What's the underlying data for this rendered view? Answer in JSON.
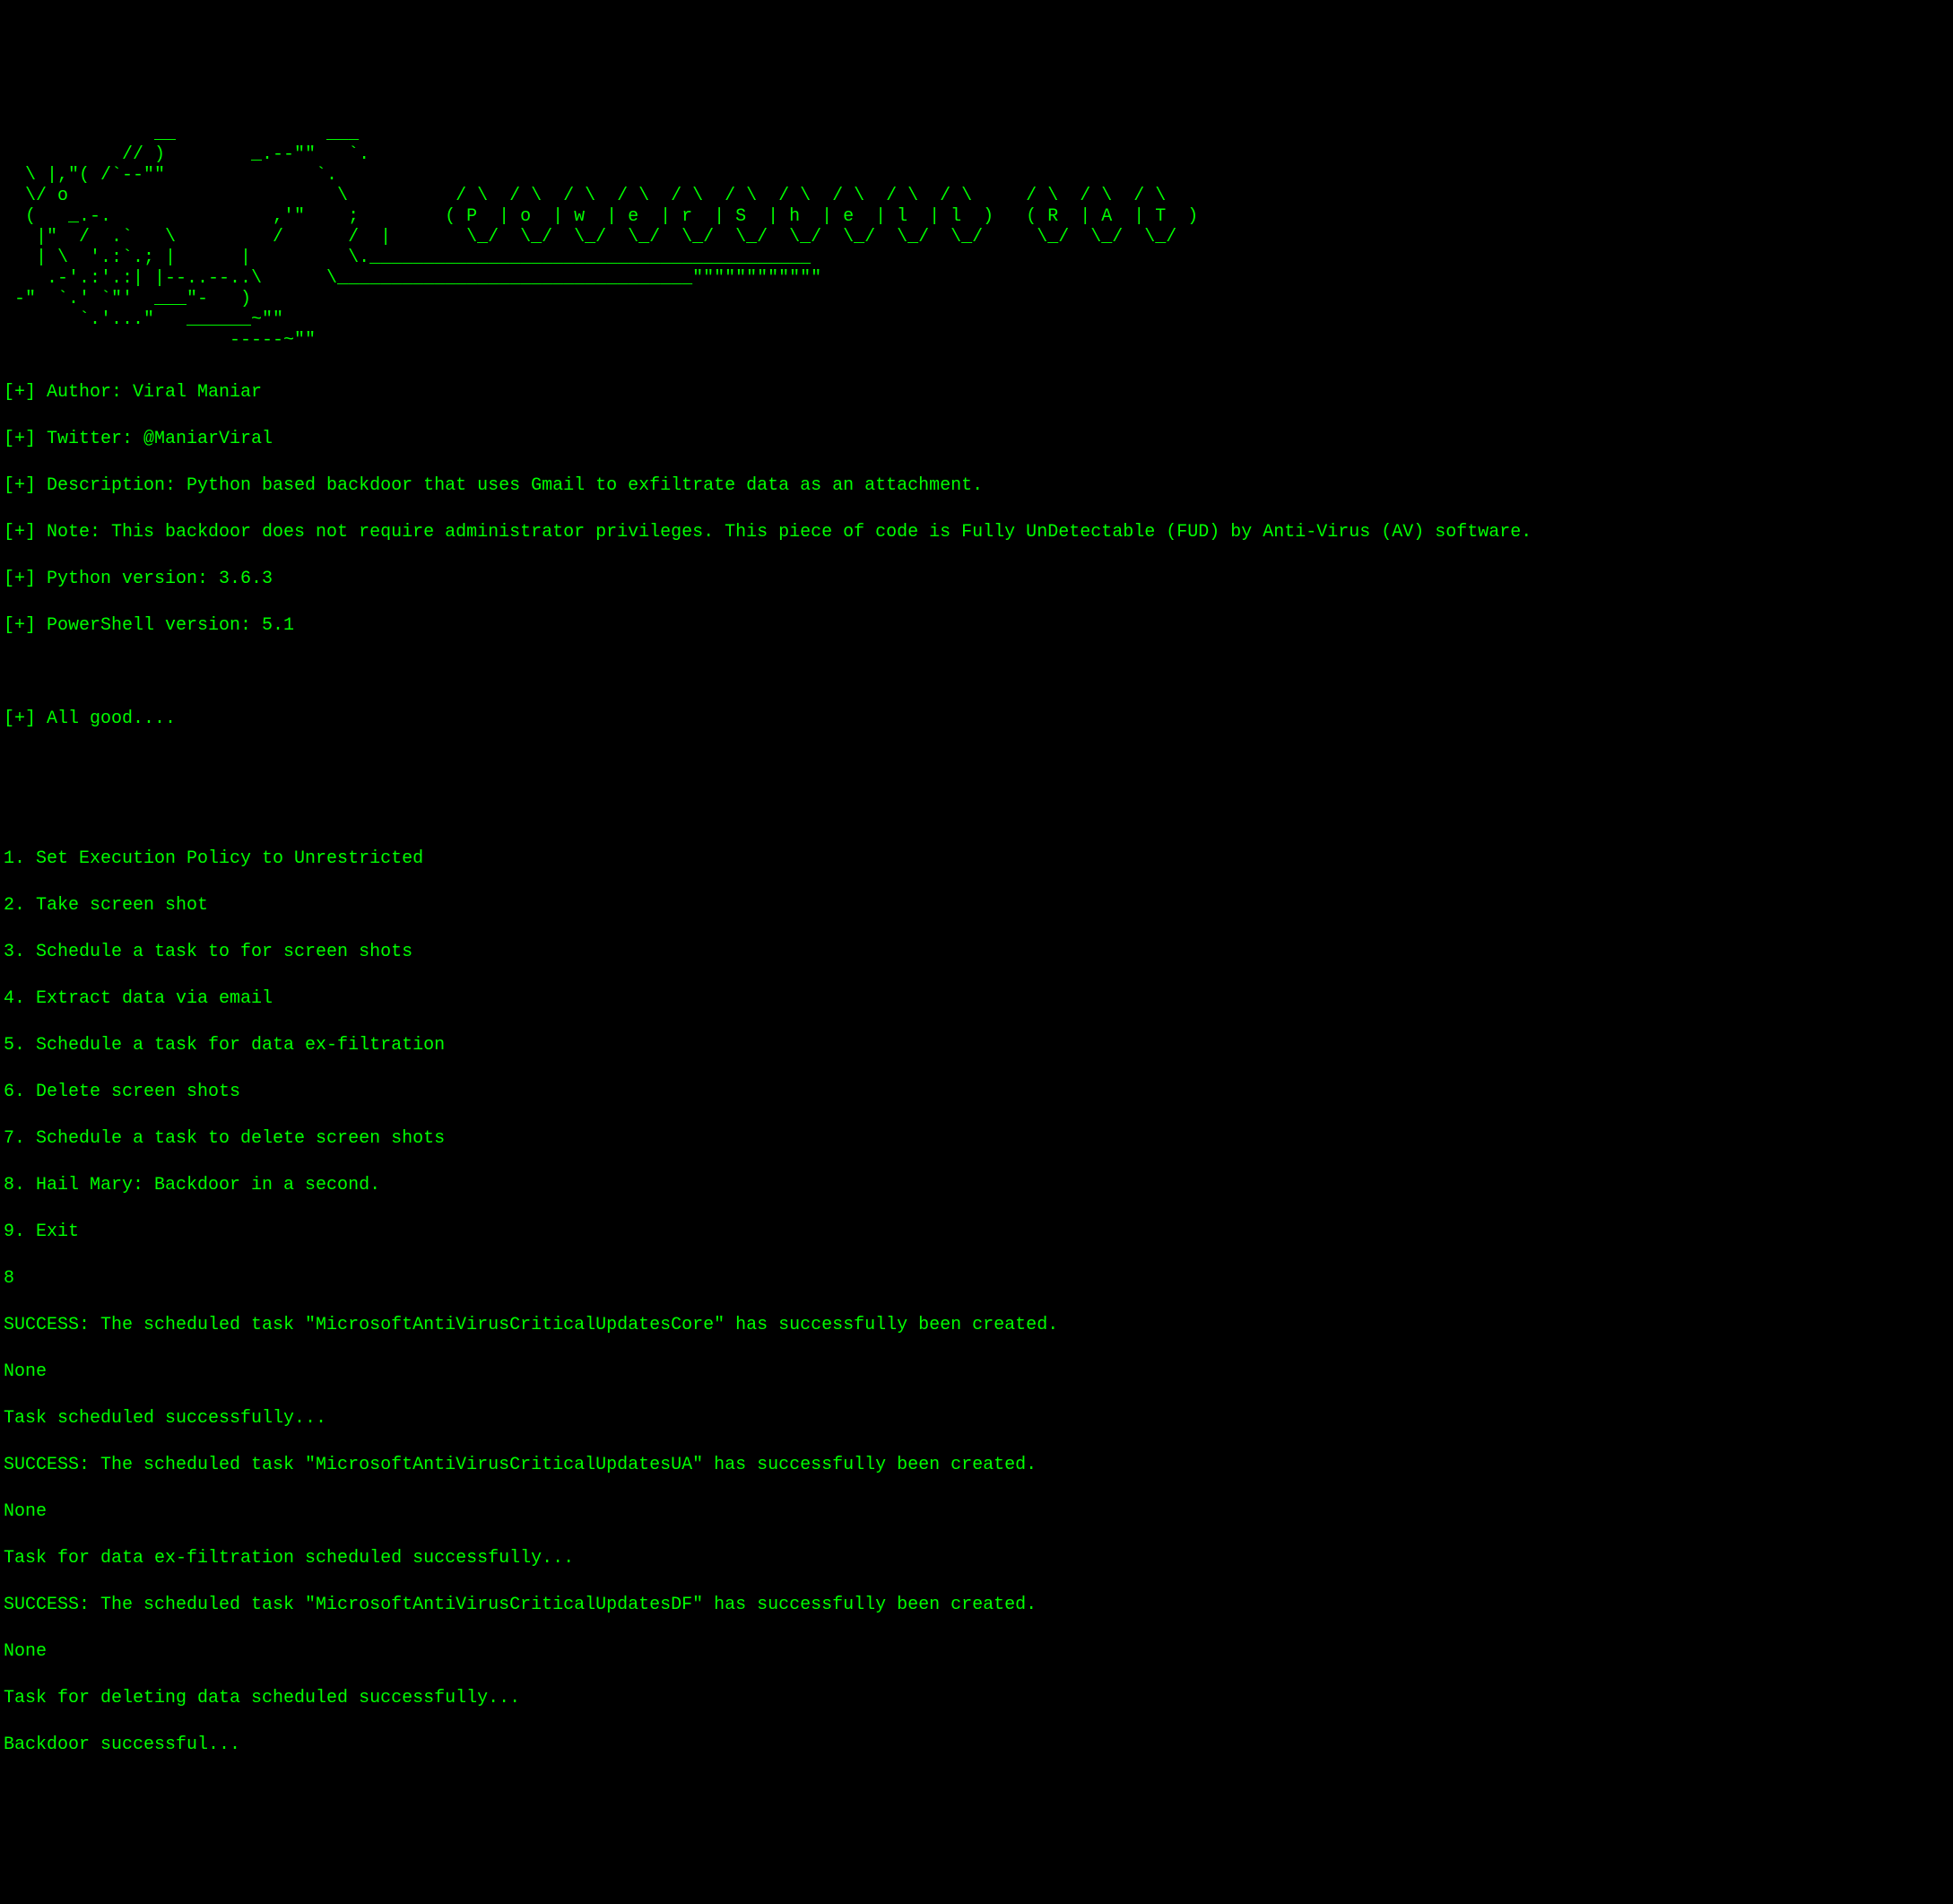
{
  "ascii_art": "              __              ___\n           // )        _.--\"\"   `.\n  \\ |,\"( /`--\"\"              `.\n  \\/ o                         \\          / \\  / \\  / \\  / \\  / \\  / \\  / \\  / \\  / \\  / \\     / \\  / \\  / \\\n  (   _.-.               ,'\"    ;        ( P  | o  | w  | e  | r  | S  | h  | e  | l  | l  )   ( R  | A  | T  )\n   |\"  /  .`   \\         /      /  |       \\_/  \\_/  \\_/  \\_/  \\_/  \\_/  \\_/  \\_/  \\_/  \\_/     \\_/  \\_/  \\_/\n   | \\  '.:`.; |      |         \\._________________________________________\n    .-'.:'.:| |--..--..\\      \\_________________________________\"\"\"\"\"\"\"\"\"\"\"\"\n -\"  `.' `\"'  ___\"-   )\n       `.'...\"   ______~\"\"\n                     -----~\"\"",
  "info": {
    "author": "[+] Author: Viral Maniar",
    "twitter": "[+] Twitter: @ManiarViral",
    "description": "[+] Description: Python based backdoor that uses Gmail to exfiltrate data as an attachment.",
    "note": "[+] Note: This backdoor does not require administrator privileges. This piece of code is Fully UnDetectable (FUD) by Anti-Virus (AV) software.",
    "python_version": "[+] Python version: 3.6.3",
    "powershell_version": "[+] PowerShell version: 5.1",
    "all_good": "[+] All good...."
  },
  "menu": {
    "items": [
      "1. Set Execution Policy to Unrestricted",
      "2. Take screen shot",
      "3. Schedule a task to for screen shots",
      "4. Extract data via email",
      "5. Schedule a task for data ex-filtration",
      "6. Delete screen shots",
      "7. Schedule a task to delete screen shots",
      "8. Hail Mary: Backdoor in a second.",
      "9. Exit"
    ]
  },
  "input": {
    "selection": "8"
  },
  "output": {
    "lines": [
      "SUCCESS: The scheduled task \"MicrosoftAntiVirusCriticalUpdatesCore\" has successfully been created.",
      "None",
      "Task scheduled successfully...",
      "SUCCESS: The scheduled task \"MicrosoftAntiVirusCriticalUpdatesUA\" has successfully been created.",
      "None",
      "Task for data ex-filtration scheduled successfully...",
      "SUCCESS: The scheduled task \"MicrosoftAntiVirusCriticalUpdatesDF\" has successfully been created.",
      "None",
      "Task for deleting data scheduled successfully...",
      "Backdoor successful..."
    ]
  }
}
